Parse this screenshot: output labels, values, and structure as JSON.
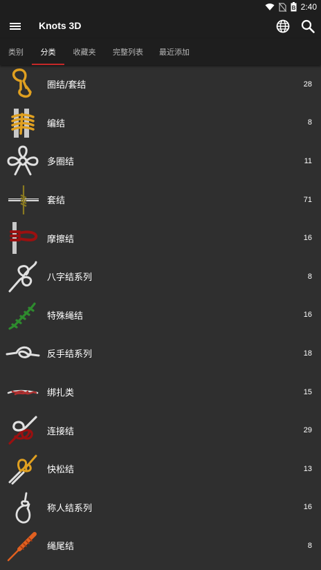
{
  "status_bar": {
    "time": "2:40",
    "battery_text": "B"
  },
  "app_bar": {
    "title": "Knots 3D"
  },
  "tabs": [
    {
      "label": "类别",
      "active": false
    },
    {
      "label": "分类",
      "active": true
    },
    {
      "label": "收藏夹",
      "active": false
    },
    {
      "label": "完整列表",
      "active": false
    },
    {
      "label": "最近添加",
      "active": false
    }
  ],
  "categories": [
    {
      "label": "圈结/套结",
      "count": "28",
      "icon": "loop-knot-icon",
      "color": "#e0a020"
    },
    {
      "label": "编结",
      "count": "8",
      "icon": "binding-knot-icon",
      "color": "#e0a020"
    },
    {
      "label": "多圈结",
      "count": "11",
      "icon": "multi-loop-knot-icon",
      "color": "#e0e0e0"
    },
    {
      "label": "套结",
      "count": "71",
      "icon": "hitch-knot-icon",
      "color": "#8a7a20"
    },
    {
      "label": "摩擦结",
      "count": "16",
      "icon": "friction-knot-icon",
      "color": "#9a1010"
    },
    {
      "label": "八字结系列",
      "count": "8",
      "icon": "figure-eight-knot-icon",
      "color": "#e0e0e0"
    },
    {
      "label": "特殊绳结",
      "count": "16",
      "icon": "special-knot-icon",
      "color": "#2e8b2e"
    },
    {
      "label": "反手结系列",
      "count": "18",
      "icon": "overhand-knot-icon",
      "color": "#e0e0e0"
    },
    {
      "label": "绑扎类",
      "count": "15",
      "icon": "lashing-knot-icon",
      "color": "#b03030"
    },
    {
      "label": "连接结",
      "count": "29",
      "icon": "bend-knot-icon",
      "color": "#9a1010"
    },
    {
      "label": "快松结",
      "count": "13",
      "icon": "quick-release-knot-icon",
      "color": "#e0a020"
    },
    {
      "label": "称人结系列",
      "count": "16",
      "icon": "bowline-knot-icon",
      "color": "#e0e0e0"
    },
    {
      "label": "绳尾结",
      "count": "8",
      "icon": "stopper-knot-icon",
      "color": "#e06020"
    }
  ]
}
